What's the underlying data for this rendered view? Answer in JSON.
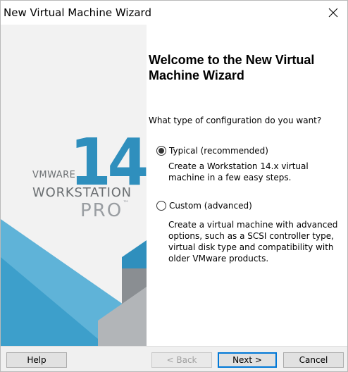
{
  "window": {
    "title": "New Virtual Machine Wizard"
  },
  "branding": {
    "vendor": "VMWARE",
    "version": "14",
    "product": "WORKSTATION",
    "edition": "PRO",
    "trademark": "™",
    "colors": {
      "blue": "#2f8fbd",
      "light_blue": "#5fb3d8",
      "gray": "#8a8e92",
      "dark_gray": "#6b6f72"
    }
  },
  "main": {
    "heading": "Welcome to the New Virtual Machine Wizard",
    "question": "What type of configuration do you want?",
    "options": [
      {
        "label": "Typical (recommended)",
        "selected": true,
        "description": "Create a Workstation 14.x virtual machine in a few easy steps."
      },
      {
        "label": "Custom (advanced)",
        "selected": false,
        "description": "Create a virtual machine with advanced options, such as a SCSI controller type, virtual disk type and compatibility with older VMware products."
      }
    ]
  },
  "buttons": {
    "help": "Help",
    "back": "< Back",
    "next": "Next >",
    "cancel": "Cancel"
  }
}
